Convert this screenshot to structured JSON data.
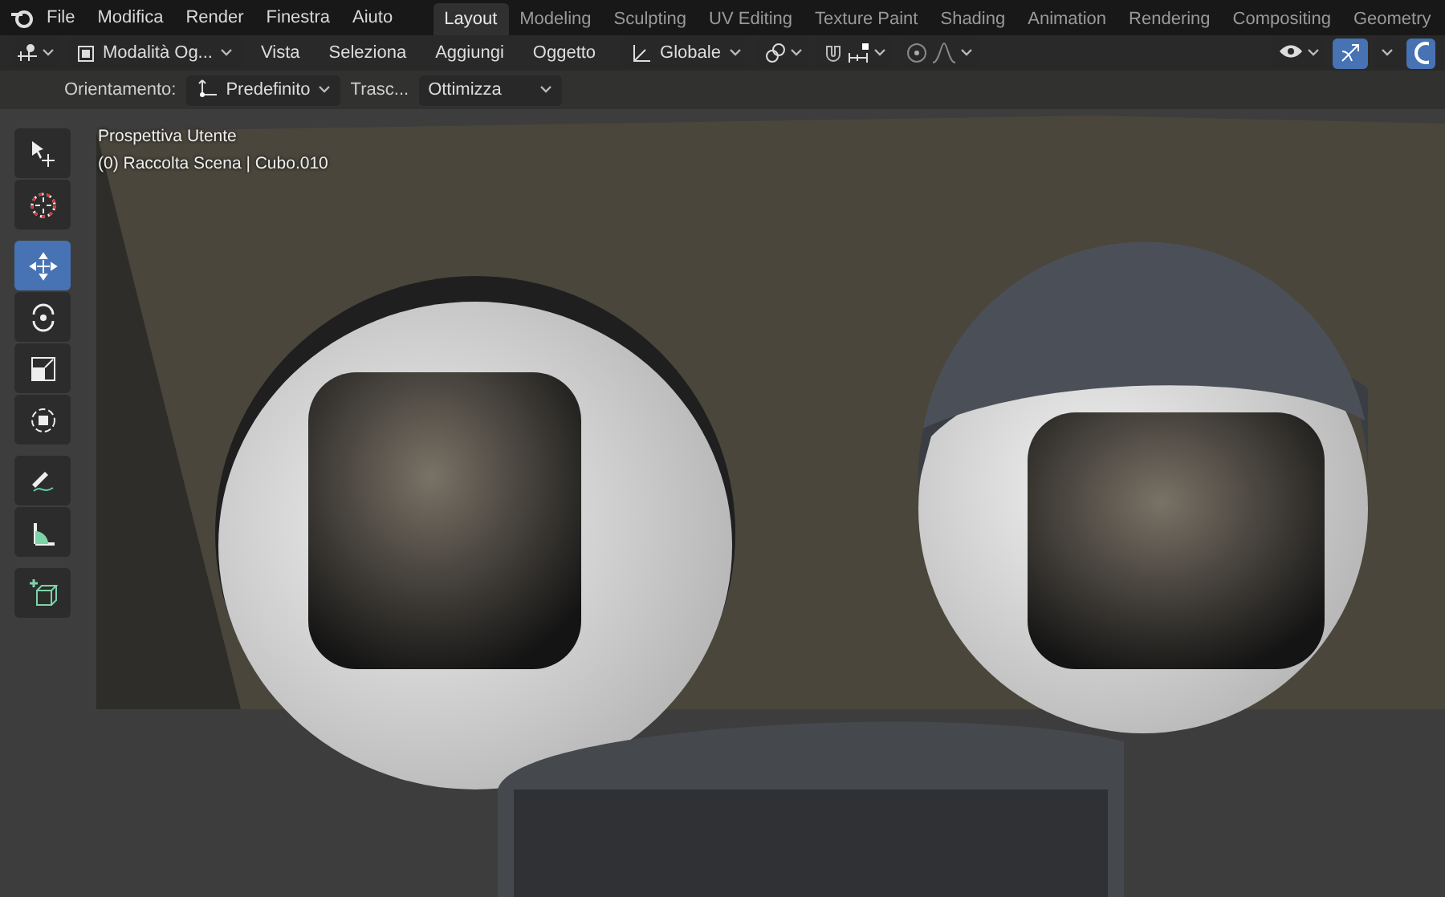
{
  "topbar": {
    "menus": [
      "File",
      "Modifica",
      "Render",
      "Finestra",
      "Aiuto"
    ],
    "workspaces": [
      {
        "label": "Layout",
        "selected": true
      },
      {
        "label": "Modeling",
        "selected": false
      },
      {
        "label": "Sculpting",
        "selected": false
      },
      {
        "label": "UV Editing",
        "selected": false
      },
      {
        "label": "Texture Paint",
        "selected": false
      },
      {
        "label": "Shading",
        "selected": false
      },
      {
        "label": "Animation",
        "selected": false
      },
      {
        "label": "Rendering",
        "selected": false
      },
      {
        "label": "Compositing",
        "selected": false
      },
      {
        "label": "Geometry",
        "selected": false
      }
    ]
  },
  "header": {
    "mode": "Modalità Og...",
    "menus": [
      "Vista",
      "Seleziona",
      "Aggiungi",
      "Oggetto"
    ],
    "transform_orientation": "Globale",
    "gizmo_on": true
  },
  "tool_settings": {
    "orientation_label": "Orientamento:",
    "orientation": "Predefinito",
    "drag_label": "Trasc...",
    "drag": "Ottimizza"
  },
  "viewport": {
    "view_name": "Prospettiva Utente",
    "object_info": "(0) Raccolta Scena | Cubo.010"
  },
  "tools": [
    {
      "kind": "select",
      "selected": false
    },
    {
      "kind": "cursor",
      "selected": false
    },
    {
      "kind": "move",
      "selected": true
    },
    {
      "kind": "rotate",
      "selected": false
    },
    {
      "kind": "scale",
      "selected": false
    },
    {
      "kind": "transform",
      "selected": false
    },
    {
      "kind": "annotate",
      "selected": false
    },
    {
      "kind": "measure",
      "selected": false
    },
    {
      "kind": "add-cube",
      "selected": false
    }
  ]
}
